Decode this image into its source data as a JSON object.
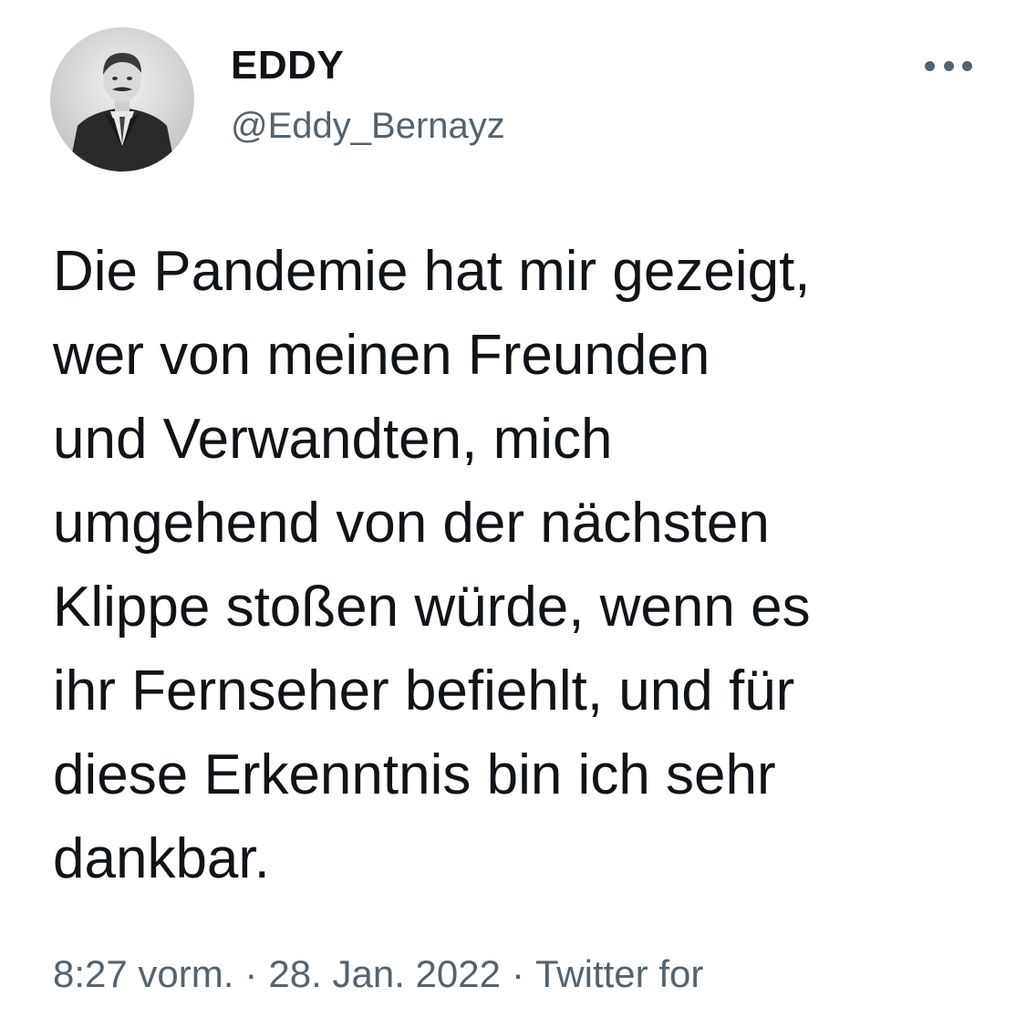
{
  "author": {
    "display_name": "EDDY",
    "handle": "@Eddy_Bernayz",
    "avatar_icon": "profile-photo"
  },
  "more_icon": "more-horizontal-icon",
  "tweet": {
    "text": "Die Pandemie hat mir gezeigt,\nwer von meinen Freunden\nund Verwandten, mich\numgehend von der nächsten\nKlippe stoßen würde, wenn es\nihr Fernseher befiehlt, und für\ndiese Erkenntnis bin ich sehr\ndankbar."
  },
  "meta": {
    "time": "8:27 vorm.",
    "separator": "·",
    "date": "28. Jan. 2022",
    "source": "Twitter for"
  },
  "colors": {
    "text": "#0f1419",
    "secondary": "#536471",
    "background": "#ffffff"
  }
}
